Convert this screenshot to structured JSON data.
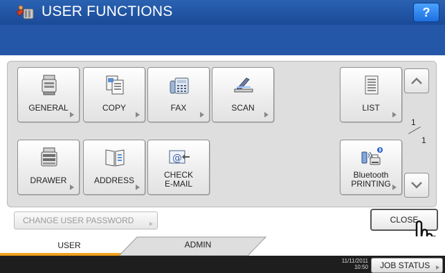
{
  "header": {
    "title": "USER FUNCTIONS",
    "help_label": "?"
  },
  "functions": {
    "general": "GENERAL",
    "copy": "COPY",
    "fax": "FAX",
    "scan": "SCAN",
    "list": "LIST",
    "drawer": "DRAWER",
    "address": "ADDRESS",
    "check_email_line1": "CHECK",
    "check_email_line2": "E-MAIL",
    "bluetooth_line1": "Bluetooth",
    "bluetooth_line2": "PRINTING"
  },
  "pagination": {
    "current": "1",
    "total": "1"
  },
  "actions": {
    "change_password": "CHANGE USER PASSWORD",
    "close": "CLOSE"
  },
  "tabs": {
    "user": "USER",
    "admin": "ADMIN"
  },
  "status": {
    "date": "11/11/2011",
    "time": "10:50",
    "job_status": "JOB STATUS"
  },
  "colors": {
    "title_bar": "#2557a8",
    "tab_accent": "#f1a11c",
    "status_bar": "#1e1e1e"
  }
}
